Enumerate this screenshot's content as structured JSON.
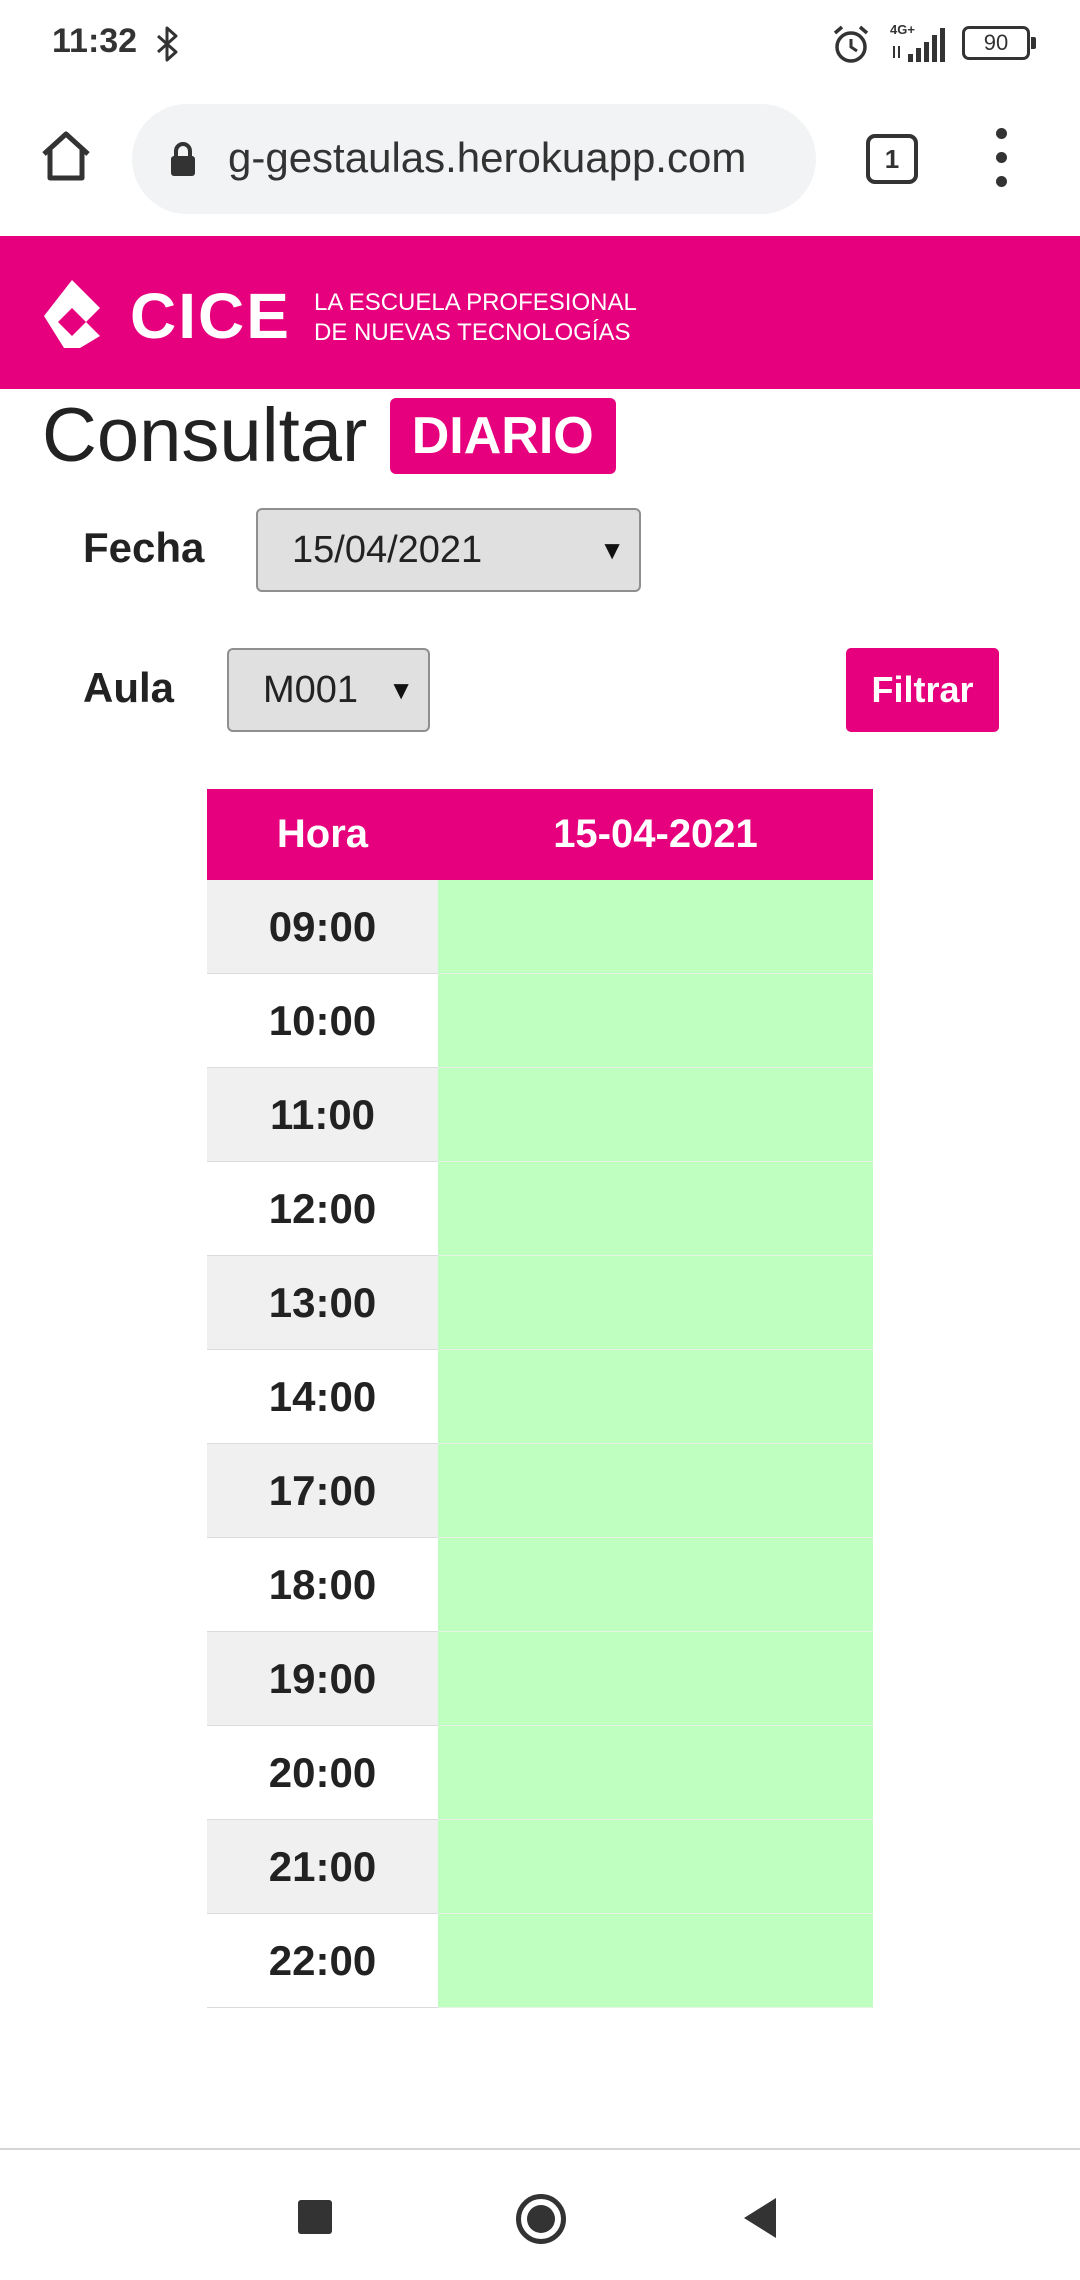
{
  "status_bar": {
    "time": "11:32",
    "network": "4G+",
    "battery": "90",
    "icons": [
      "bluetooth-icon",
      "alarm-icon",
      "signal-icon",
      "battery-icon"
    ]
  },
  "browser": {
    "url": "g-gestaulas.herokuapp.com",
    "tab_count": "1",
    "icons": [
      "home-icon",
      "lock-icon",
      "tabs-icon",
      "more-vert-icon"
    ]
  },
  "header": {
    "logo_text": "CICE",
    "tagline_line1": "LA ESCUELA PROFESIONAL",
    "tagline_line2": "DE NUEVAS TECNOLOGÍAS",
    "brand_color": "#e6007e"
  },
  "page": {
    "title": "Consultar",
    "mode": "DIARIO"
  },
  "form": {
    "date_label": "Fecha",
    "date_value": "15/04/2021",
    "room_label": "Aula",
    "room_value": "M001",
    "filter_label": "Filtrar"
  },
  "schedule": {
    "header_hour": "Hora",
    "header_day": "15-04-2021",
    "slot_free_color": "#bfffbf",
    "hours": [
      "09:00",
      "10:00",
      "11:00",
      "12:00",
      "13:00",
      "14:00",
      "17:00",
      "18:00",
      "19:00",
      "20:00",
      "21:00",
      "22:00"
    ]
  },
  "nav": {
    "icons": [
      "recents-icon",
      "home-circle-icon",
      "back-icon"
    ]
  }
}
